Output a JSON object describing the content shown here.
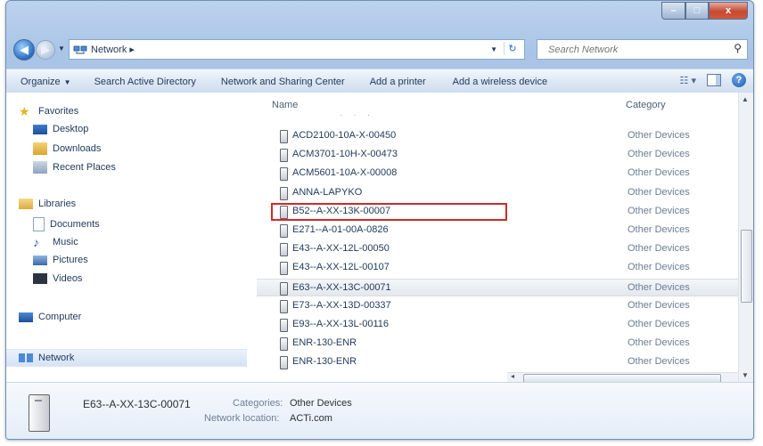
{
  "window": {
    "buttons": {
      "minimize": "–",
      "maximize": "□",
      "close": "x"
    }
  },
  "address": {
    "crumb": "Network ▸",
    "search_placeholder": "Search Network"
  },
  "toolbar": {
    "organize": "Organize",
    "search_ad": "Search Active Directory",
    "network_center": "Network and Sharing Center",
    "add_printer": "Add a printer",
    "add_wireless": "Add a wireless device"
  },
  "nav": {
    "favorites": "Favorites",
    "desktop": "Desktop",
    "downloads": "Downloads",
    "recent": "Recent Places",
    "libraries": "Libraries",
    "documents": "Documents",
    "music": "Music",
    "pictures": "Pictures",
    "videos": "Videos",
    "computer": "Computer",
    "network": "Network"
  },
  "columns": {
    "name": "Name",
    "category": "Category"
  },
  "devices": [
    {
      "name": "ACD2100-10A-X-00450",
      "category": "Other Devices"
    },
    {
      "name": "ACM3701-10H-X-00473",
      "category": "Other Devices"
    },
    {
      "name": "ACM5601-10A-X-00008",
      "category": "Other Devices"
    },
    {
      "name": "ANNA-LAPYKO",
      "category": "Other Devices"
    },
    {
      "name": "B52--A-XX-13K-00007",
      "category": "Other Devices"
    },
    {
      "name": "E271--A-01-00A-0826",
      "category": "Other Devices"
    },
    {
      "name": "E43--A-XX-12L-00050",
      "category": "Other Devices"
    },
    {
      "name": "E43--A-XX-12L-00107",
      "category": "Other Devices"
    },
    {
      "name": "E63--A-XX-13C-00071",
      "category": "Other Devices"
    },
    {
      "name": "E73--A-XX-13D-00337",
      "category": "Other Devices"
    },
    {
      "name": "E93--A-XX-13L-00116",
      "category": "Other Devices"
    },
    {
      "name": "ENR-130-ENR",
      "category": "Other Devices"
    },
    {
      "name": "ENR-130-ENR",
      "category": "Other Devices"
    }
  ],
  "highlighted_index": 4,
  "selected_index": 8,
  "details": {
    "name": "E63--A-XX-13C-00071",
    "categories_label": "Categories:",
    "categories_value": "Other Devices",
    "location_label": "Network location:",
    "location_value": "ACTi.com"
  },
  "colors": {
    "highlight_box": "#d12a2a",
    "text": "#1e395b"
  }
}
